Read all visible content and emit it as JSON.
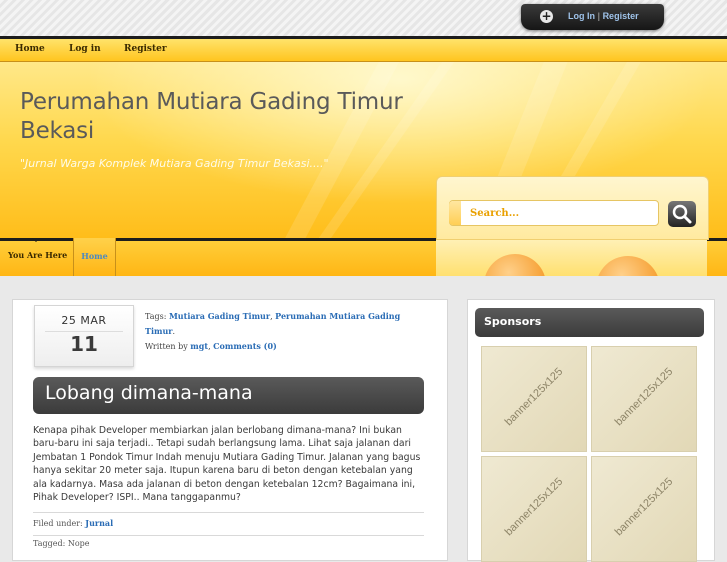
{
  "topbar": {
    "login_label": "Log In",
    "separator": "|",
    "register_label": "Register"
  },
  "nav": {
    "items": [
      {
        "label": "Home"
      },
      {
        "label": "Log in"
      },
      {
        "label": "Register"
      }
    ]
  },
  "header": {
    "title": "Perumahan Mutiara Gading Timur Bekasi",
    "tagline": "\"Jurnal Warga Komplek Mutiara Gading Timur Bekasi....\"",
    "search_placeholder": "Search..."
  },
  "breadcrumb": {
    "label": "You Are Here",
    "home": "Home"
  },
  "post": {
    "date_day": "25",
    "date_month": "MAR",
    "date_year": "11",
    "tags_label": "Tags:",
    "tag1": "Mutiara Gading Timur",
    "tag2": "Perumahan Mutiara Gading Timur",
    "written_label": "Written by",
    "author": "mgt",
    "comments": "Comments (0)",
    "title": "Lobang dimana-mana",
    "body": "Kenapa pihak Developer membiarkan jalan berlobang dimana-mana? Ini  bukan baru-baru ini saja terjadi.. Tetapi sudah berlangsung lama. Lihat saja jalanan dari Jembatan 1 Pondok Timur Indah menuju Mutiara Gading Timur. Jalanan yang bagus hanya sekitar 20 meter saja. Itupun karena baru di beton dengan ketebalan yang ala kadarnya. Masa ada jalanan di beton dengan ketebalan 12cm? Bagaimana ini, Pihak Developer? ISPI.. Mana tanggapanmu?",
    "filed_label": "Filed under:",
    "category": "Jurnal",
    "tagged_label": "Tagged: Nope"
  },
  "sidebar": {
    "sponsors_title": "Sponsors",
    "banners": [
      "banner125x125",
      "banner125x125",
      "banner125x125",
      "banner125x125"
    ]
  },
  "colors": {
    "accent_yellow": "#ffc51f",
    "link_blue": "#2a6cb5",
    "dark_panel": "#3b3b3b"
  }
}
